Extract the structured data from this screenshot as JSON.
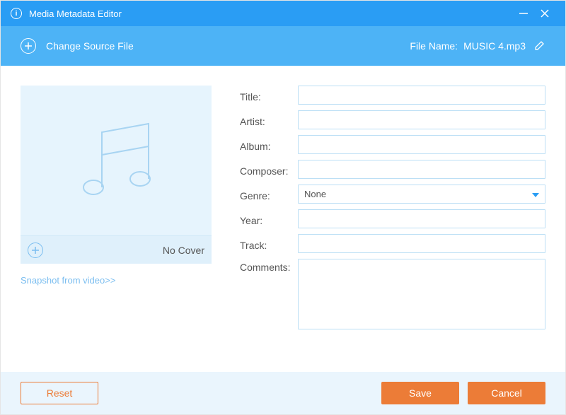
{
  "window": {
    "title": "Media Metadata Editor"
  },
  "subheader": {
    "change_source": "Change Source File",
    "filename_label": "File Name:",
    "filename_value": "MUSIC 4.mp3"
  },
  "cover": {
    "no_cover_label": "No Cover",
    "snapshot_link": "Snapshot from video>>"
  },
  "form": {
    "labels": {
      "title": "Title:",
      "artist": "Artist:",
      "album": "Album:",
      "composer": "Composer:",
      "genre": "Genre:",
      "year": "Year:",
      "track": "Track:",
      "comments": "Comments:"
    },
    "values": {
      "title": "",
      "artist": "",
      "album": "",
      "composer": "",
      "genre": "None",
      "year": "",
      "track": "",
      "comments": ""
    }
  },
  "footer": {
    "reset": "Reset",
    "save": "Save",
    "cancel": "Cancel"
  },
  "colors": {
    "titlebar": "#2a9df4",
    "subheader": "#4db3f6",
    "accent_orange": "#ec7c37",
    "cover_bg": "#e6f4fd",
    "input_border": "#bcdff5"
  }
}
